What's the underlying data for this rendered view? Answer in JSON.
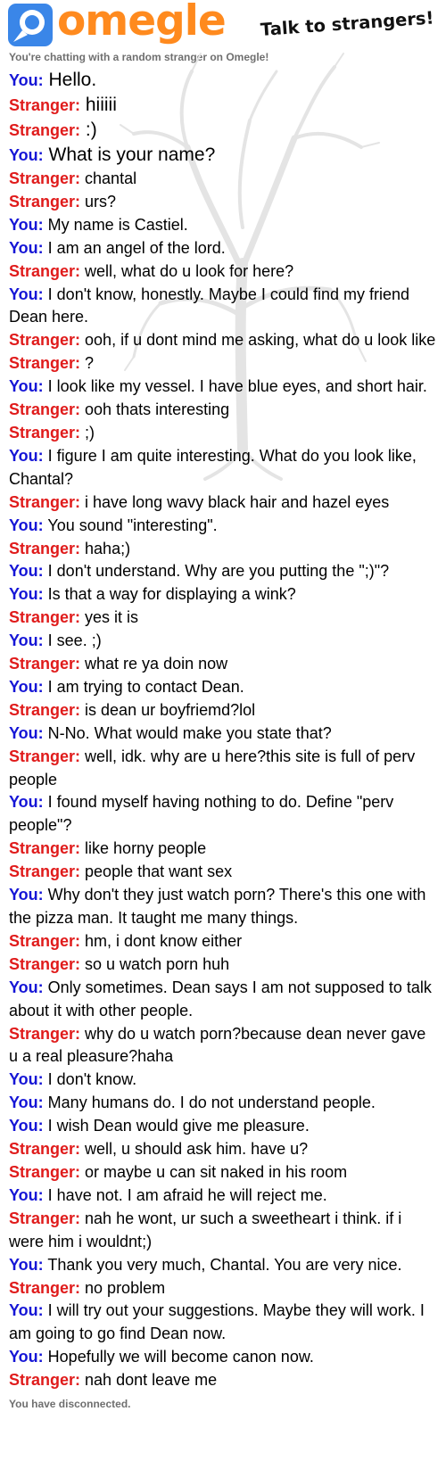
{
  "header": {
    "brand": "omegle",
    "tagline": "Talk to strangers!",
    "subtitle": "You're chatting with a random stranger on Omegle!"
  },
  "labels": {
    "you": "You:",
    "stranger": "Stranger:"
  },
  "colors": {
    "you": "#1515d6",
    "stranger": "#e01b1b",
    "brand_orange": "#ff8a1e",
    "brand_blue": "#3a86e8"
  },
  "messages": [
    {
      "from": "you",
      "text": "Hello.",
      "big": true
    },
    {
      "from": "stranger",
      "text": "hiiiii",
      "big": true
    },
    {
      "from": "stranger",
      "text": ":)",
      "big": true
    },
    {
      "from": "you",
      "text": "What is your name?",
      "big": true
    },
    {
      "from": "stranger",
      "text": "chantal"
    },
    {
      "from": "stranger",
      "text": "urs?"
    },
    {
      "from": "you",
      "text": "My name is Castiel."
    },
    {
      "from": "you",
      "text": "I am an angel of the lord."
    },
    {
      "from": "stranger",
      "text": "well, what do u look for here?"
    },
    {
      "from": "you",
      "text": "I don't know, honestly. Maybe I could find my friend Dean here."
    },
    {
      "from": "stranger",
      "text": "ooh, if u dont mind me asking, what do u look like"
    },
    {
      "from": "stranger",
      "text": "?"
    },
    {
      "from": "you",
      "text": "I look like my vessel. I have blue eyes, and short hair."
    },
    {
      "from": "stranger",
      "text": "ooh thats interesting"
    },
    {
      "from": "stranger",
      "text": ";)"
    },
    {
      "from": "you",
      "text": "I figure I am quite interesting. What do you look like, Chantal?"
    },
    {
      "from": "stranger",
      "text": "i have long wavy black hair and hazel eyes"
    },
    {
      "from": "you",
      "text": "You sound \"interesting\"."
    },
    {
      "from": "stranger",
      "text": "haha;)"
    },
    {
      "from": "you",
      "text": "I don't understand. Why are you putting the \";)\"?"
    },
    {
      "from": "you",
      "text": "Is that a way for displaying a wink?"
    },
    {
      "from": "stranger",
      "text": "yes it is"
    },
    {
      "from": "you",
      "text": "I see. ;)"
    },
    {
      "from": "stranger",
      "text": "what re ya doin now"
    },
    {
      "from": "you",
      "text": "I am trying to contact Dean."
    },
    {
      "from": "stranger",
      "text": "is dean ur boyfriemd?lol"
    },
    {
      "from": "you",
      "text": "N-No. What would make you state that?"
    },
    {
      "from": "stranger",
      "text": "well, idk. why are u here?this site is full of perv people"
    },
    {
      "from": "you",
      "text": "I found myself having nothing to do. Define \"perv people\"?"
    },
    {
      "from": "stranger",
      "text": "like horny people"
    },
    {
      "from": "stranger",
      "text": "people that want sex"
    },
    {
      "from": "you",
      "text": "Why don't they just watch porn? There's this one with the pizza man. It taught me many things."
    },
    {
      "from": "stranger",
      "text": "hm, i dont know either"
    },
    {
      "from": "stranger",
      "text": "so u watch porn huh"
    },
    {
      "from": "you",
      "text": "Only sometimes. Dean says I am not supposed to talk about it with other people."
    },
    {
      "from": "stranger",
      "text": "why do u watch porn?because dean never gave u a real pleasure?haha"
    },
    {
      "from": "you",
      "text": "I don't know."
    },
    {
      "from": "you",
      "text": "Many humans do. I do not understand people."
    },
    {
      "from": "you",
      "text": "I wish Dean would give me pleasure."
    },
    {
      "from": "stranger",
      "text": "well, u should ask him. have u?"
    },
    {
      "from": "stranger",
      "text": "or maybe u can sit naked in his room"
    },
    {
      "from": "you",
      "text": "I have not. I am afraid he will reject me."
    },
    {
      "from": "stranger",
      "text": "nah he wont, ur such a sweetheart i think. if i were him i wouldnt;)"
    },
    {
      "from": "you",
      "text": "Thank you very much, Chantal. You are very nice."
    },
    {
      "from": "stranger",
      "text": "no problem"
    },
    {
      "from": "you",
      "text": "I will try out your suggestions. Maybe they will work. I am going to go find Dean now."
    },
    {
      "from": "you",
      "text": "Hopefully we will become canon now."
    },
    {
      "from": "stranger",
      "text": "nah dont leave me"
    }
  ],
  "status": "You have disconnected."
}
